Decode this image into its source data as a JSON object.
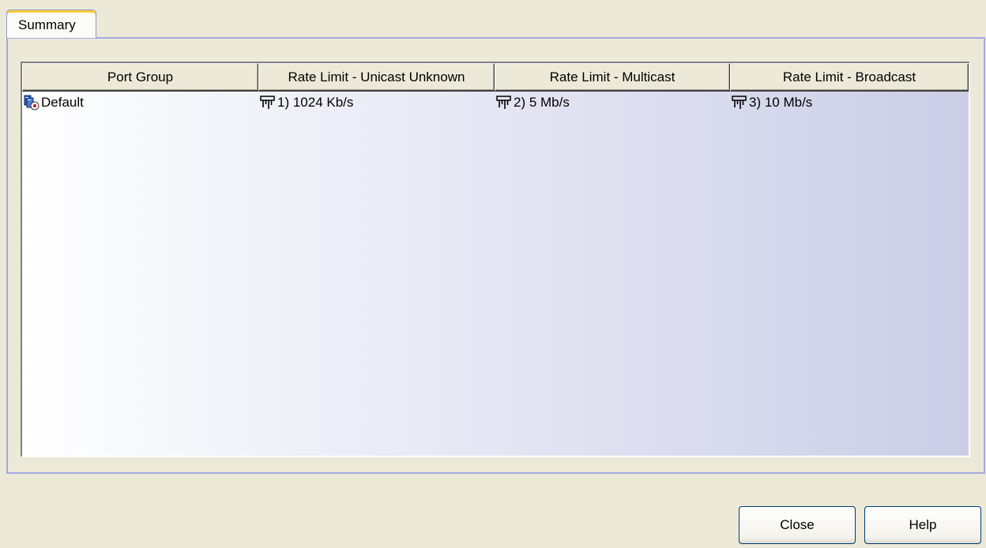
{
  "tabs": [
    {
      "label": "Summary",
      "selected": true
    }
  ],
  "table": {
    "columns": [
      "Port Group",
      "Rate Limit - Unicast Unknown",
      "Rate Limit - Multicast",
      "Rate Limit - Broadcast"
    ],
    "rows": [
      {
        "port_group": {
          "icon": "port-group-icon",
          "text": "Default"
        },
        "unicast_unknown": {
          "icon": "rate-limit-icon",
          "text": "1) 1024 Kb/s"
        },
        "multicast": {
          "icon": "rate-limit-icon",
          "text": "2) 5 Mb/s"
        },
        "broadcast": {
          "icon": "rate-limit-icon",
          "text": "3) 10 Mb/s"
        }
      }
    ]
  },
  "buttons": {
    "close": "Close",
    "help": "Help"
  },
  "colors": {
    "window_background": "#ece9d8",
    "panel_border": "#a4aae0",
    "tab_highlight": "#ffc83c",
    "button_border": "#003c74",
    "table_gradient_start": "#ffffff",
    "table_gradient_end": "#cbcde6"
  }
}
